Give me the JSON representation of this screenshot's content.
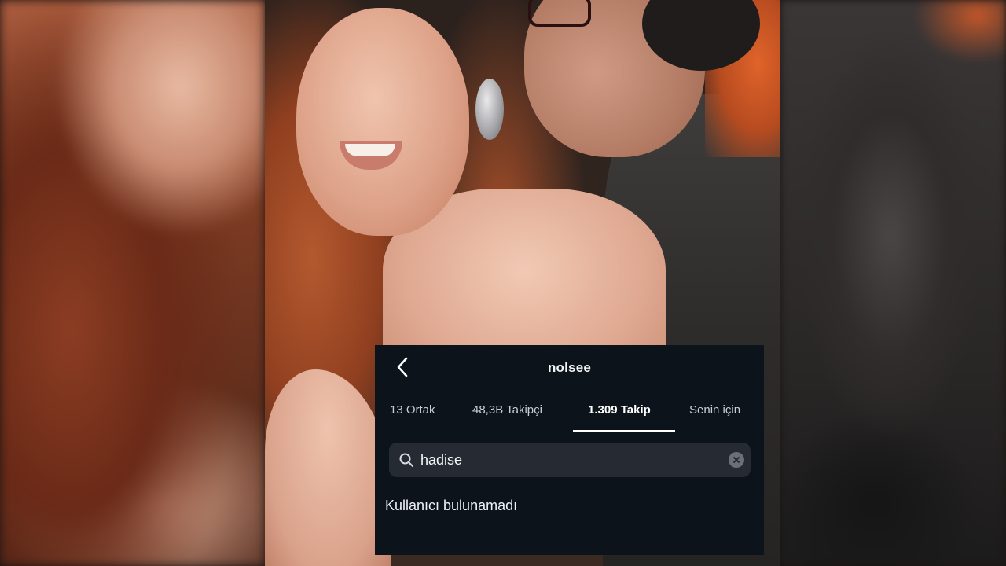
{
  "profile": {
    "username": "nolsee"
  },
  "tabs": [
    {
      "label": "13 Ortak",
      "active": false
    },
    {
      "label": "48,3B Takipçi",
      "active": false
    },
    {
      "label": "1.309 Takip",
      "active": true
    },
    {
      "label": "Senin için",
      "active": false
    }
  ],
  "search": {
    "value": "hadise",
    "icon": "search-icon",
    "clear_icon": "clear-icon"
  },
  "results": {
    "empty_message": "Kullanıcı bulunamadı"
  },
  "icons": {
    "back": "back-arrow-icon"
  },
  "colors": {
    "panel_bg": "#0d131b",
    "search_bg": "#262b33",
    "active_tab": "#ffffff",
    "inactive_tab": "#c9ced4"
  }
}
